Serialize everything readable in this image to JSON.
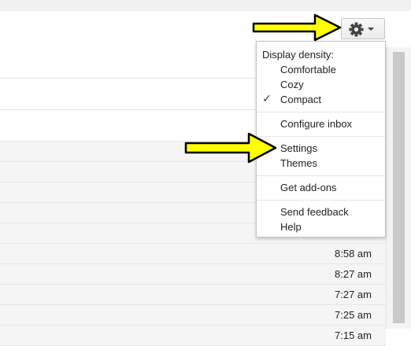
{
  "gear_menu": {
    "display_density_label": "Display density:",
    "density_options": [
      "Comfortable",
      "Cozy",
      "Compact"
    ],
    "selected_density": "Compact",
    "configure_inbox": "Configure inbox",
    "settings": "Settings",
    "themes": "Themes",
    "get_addons": "Get add-ons",
    "send_feedback": "Send feedback",
    "help": "Help"
  },
  "emails": {
    "times": [
      "8:58 am",
      "8:27 am",
      "7:27 am",
      "7:25 am",
      "7:15 am"
    ]
  },
  "icons": {
    "settings": "gear-icon",
    "dropdown": "caret-down-icon",
    "selected": "checkmark-icon",
    "annotation": "yellow-arrow"
  },
  "colors": {
    "arrow_fill": "#ffff00",
    "arrow_outline": "#000000"
  }
}
